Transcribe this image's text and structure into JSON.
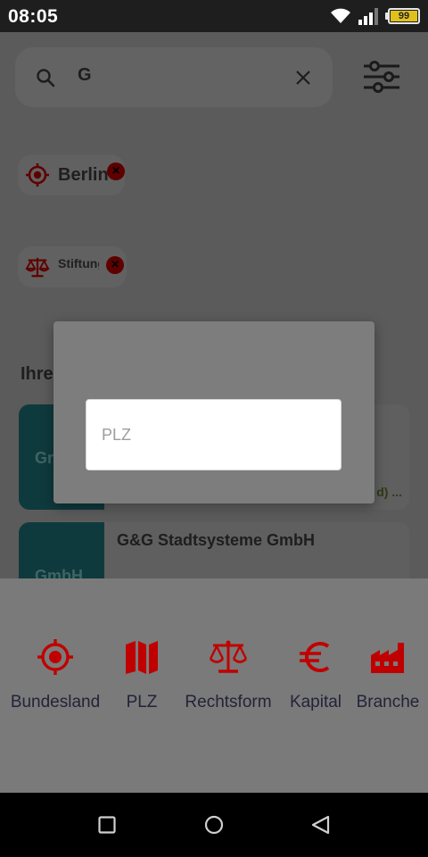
{
  "status": {
    "time": "08:05",
    "battery": "99"
  },
  "search": {
    "query": "G"
  },
  "chips": [
    {
      "label": "Berlin",
      "icon": "target-icon"
    },
    {
      "label": "Stiftung",
      "icon": "scales-icon"
    }
  ],
  "section": {
    "title": "Ihre"
  },
  "results": [
    {
      "thumb": "Gr",
      "title": "",
      "tag": "d) ..."
    },
    {
      "thumb": "GmbH",
      "title": "G&G Stadtsysteme GmbH"
    }
  ],
  "dialog": {
    "placeholder": "PLZ",
    "value": ""
  },
  "filter_options": [
    {
      "label": "Bundesland",
      "icon": "target-icon"
    },
    {
      "label": "PLZ",
      "icon": "map-icon"
    },
    {
      "label": "Rechtsform",
      "icon": "scales-icon"
    },
    {
      "label": "Kapital",
      "icon": "euro-icon"
    },
    {
      "label": "Branche",
      "icon": "factory-icon"
    }
  ],
  "colors": {
    "accent": "#c00000",
    "dim_accent": "#5f0000",
    "label": "#23233a"
  }
}
